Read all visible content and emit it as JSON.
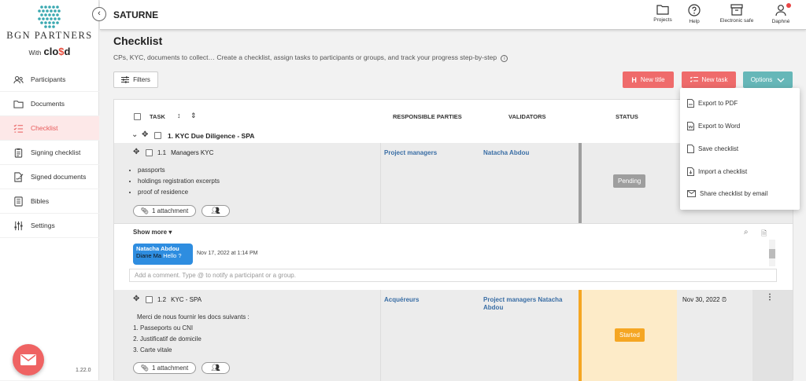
{
  "sidebar": {
    "brand": "BGN PARTNERS",
    "with_label": "With",
    "partner_logo_a": "clo",
    "partner_logo_b": "$",
    "partner_logo_c": "d",
    "items": [
      {
        "label": "Participants",
        "icon": "users-icon"
      },
      {
        "label": "Documents",
        "icon": "folder-icon"
      },
      {
        "label": "Checklist",
        "icon": "checklist-icon",
        "active": true
      },
      {
        "label": "Signing checklist",
        "icon": "clipboard-icon"
      },
      {
        "label": "Signed documents",
        "icon": "signed-doc-icon"
      },
      {
        "label": "Bibles",
        "icon": "book-icon"
      },
      {
        "label": "Settings",
        "icon": "sliders-icon"
      }
    ],
    "version": "1.22.0"
  },
  "topbar": {
    "project": "SATURNE",
    "actions": [
      {
        "label": "Projects",
        "icon": "folder-icon"
      },
      {
        "label": "Help",
        "icon": "help-icon"
      },
      {
        "label": "Electronic safe",
        "icon": "safe-icon"
      },
      {
        "label": "Daphné",
        "icon": "user-icon"
      }
    ]
  },
  "page": {
    "title": "Checklist",
    "description": "CPs, KYC, documents to collect… Create a checklist, assign tasks to participants or groups, and track your progress step-by-step",
    "info_glyph": "i"
  },
  "toolbar": {
    "filters": "Filters",
    "new_title": "New title",
    "new_task": "New task",
    "options": "Options"
  },
  "table": {
    "headers": {
      "task": "TASK",
      "responsible": "RESPONSIBLE PARTIES",
      "validators": "VALIDATORS",
      "status": "STATUS"
    },
    "section": {
      "number": "1.",
      "title": "KYC Due Diligence - SPA"
    },
    "tasks": [
      {
        "number": "1.1",
        "title": "Managers KYC",
        "items": [
          "passports",
          "holdings registration excerpts",
          "proof of residence"
        ],
        "responsible": "Project managers",
        "validators": "Natacha Abdou",
        "status": "Pending",
        "attachments": "1 attachment"
      },
      {
        "number": "1.2",
        "title": "KYC - SPA",
        "intro": "Merci de nous fournir les docs suivants :",
        "items": [
          "Passeports ou CNI",
          "Justificatif de domicile",
          "Carte vitale"
        ],
        "responsible": "Acquéreurs",
        "validators_line1": "Project managers Natacha",
        "validators_line2": "Abdou",
        "status": "Started",
        "due_date": "Nov 30, 2022",
        "attachments": "1 attachment"
      }
    ],
    "comments": {
      "show_more": "Show more",
      "author": "Natacha Abdou",
      "mention": "Diane Ma",
      "text": "Hello ?",
      "timestamp": "Nov 17, 2022 at 1:14 PM",
      "placeholder": "Add a comment. Type @ to notify a participant or a group."
    }
  },
  "options_menu": [
    {
      "label": "Export to PDF",
      "icon": "pdf-icon"
    },
    {
      "label": "Export to Word",
      "icon": "word-icon"
    },
    {
      "label": "Save checklist",
      "icon": "save-icon"
    },
    {
      "label": "Import a checklist",
      "icon": "import-icon"
    },
    {
      "label": "Share checklist by email",
      "icon": "email-icon"
    }
  ],
  "colors": {
    "accent_red": "#ef6b6b",
    "options_teal": "#66b7b8",
    "link_blue": "#3a6ea5",
    "pending_grey": "#9e9e9e",
    "started_orange": "#f5a623"
  }
}
